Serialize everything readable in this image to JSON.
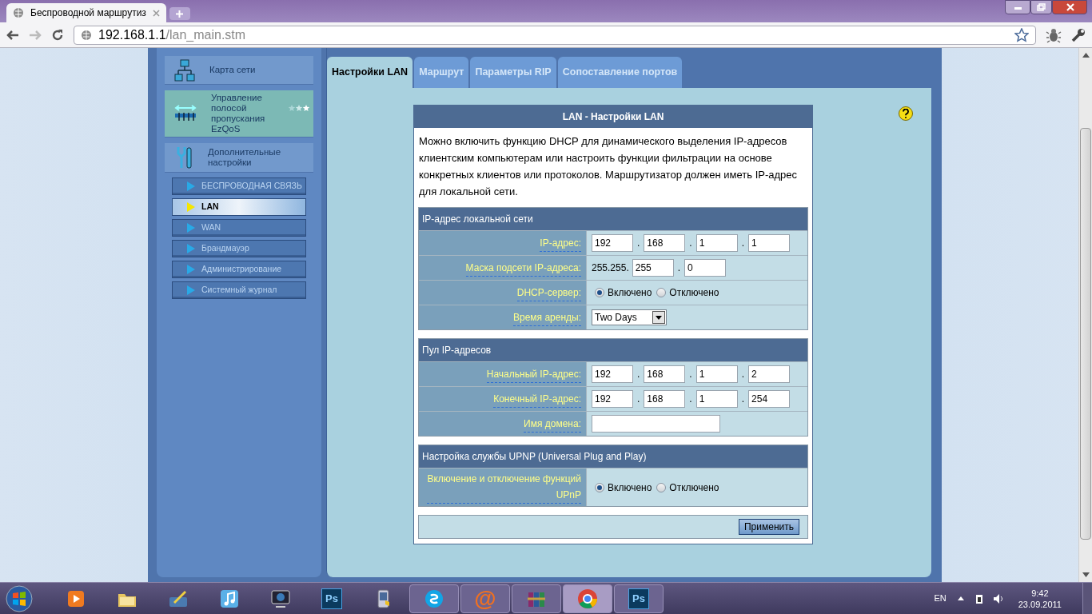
{
  "browser": {
    "tab_title": "Беспроводной маршрутиз",
    "url_host": "192.168.1.1",
    "url_path": "/lan_main.stm"
  },
  "sidebar": {
    "menu": [
      {
        "label": "Карта сети",
        "kind": "network",
        "selected": false
      },
      {
        "label": "Управление полосой пропускания EzQoS",
        "kind": "qos",
        "selected": true
      },
      {
        "label": "Дополнительные настройки",
        "kind": "tools",
        "selected": false
      }
    ],
    "submenu": [
      {
        "label": "БЕСПРОВОДНАЯ СВЯЗЬ",
        "selected": false
      },
      {
        "label": "LAN",
        "selected": true
      },
      {
        "label": "WAN",
        "selected": false
      },
      {
        "label": "Брандмауэр",
        "selected": false
      },
      {
        "label": "Администрирование",
        "selected": false
      },
      {
        "label": "Системный журнал",
        "selected": false
      }
    ]
  },
  "tabs": [
    {
      "label": "Настройки LAN",
      "selected": true
    },
    {
      "label": "Маршрут",
      "selected": false
    },
    {
      "label": "Параметры RIP",
      "selected": false
    },
    {
      "label": "Сопоставление портов",
      "selected": false
    }
  ],
  "panel": {
    "title": "LAN - Настройки LAN",
    "description": "Можно включить функцию DHCP для динамического выделения IP-адресов клиентским компьютерам или настроить функции фильтрации на основе конкретных клиентов или протоколов. Маршрутизатор должен иметь IP-адрес для локальной сети.",
    "sections": [
      {
        "title": "IP-адрес локальной сети",
        "rows": [
          {
            "kind": "ip",
            "label": "IP-адрес:",
            "separator": ".",
            "values": [
              "192",
              "168",
              "1",
              "1"
            ]
          },
          {
            "kind": "ip",
            "label": "Маска подсети IP-адреса:",
            "prefix": "255.255.",
            "separator": ".",
            "values": [
              "255",
              "0"
            ]
          },
          {
            "kind": "radio",
            "label": "DHCP-сервер:",
            "options": [
              {
                "label": "Включено",
                "selected": true
              },
              {
                "label": "Отключено",
                "selected": false
              }
            ]
          },
          {
            "kind": "select",
            "label": "Время аренды:",
            "value": "Two Days"
          }
        ]
      },
      {
        "title": "Пул IP-адресов",
        "rows": [
          {
            "kind": "ip",
            "label": "Начальный IP-адрес:",
            "separator": ".",
            "values": [
              "192",
              "168",
              "1",
              "2"
            ]
          },
          {
            "kind": "ip",
            "label": "Конечный IP-адрес:",
            "separator": ".",
            "values": [
              "192",
              "168",
              "1",
              "254"
            ]
          },
          {
            "kind": "text",
            "label": "Имя домена:"
          }
        ]
      },
      {
        "title": "Настройка службы UPNP (Universal Plug and Play)",
        "rows": [
          {
            "kind": "radio",
            "label": "Включение и отключение функций UPnP",
            "options": [
              {
                "label": "Включено",
                "selected": true
              },
              {
                "label": "Отключено",
                "selected": false
              }
            ]
          }
        ]
      }
    ],
    "apply_button": "Применить"
  },
  "taskbar": {
    "apps": [
      {
        "kind": "player",
        "open": false
      },
      {
        "kind": "folder",
        "open": false
      },
      {
        "kind": "paint",
        "open": false
      },
      {
        "kind": "music",
        "open": false
      },
      {
        "kind": "monitor",
        "open": false
      },
      {
        "kind": "ps",
        "label": "Ps",
        "open": false
      },
      {
        "kind": "phone",
        "open": false
      },
      {
        "kind": "cloud",
        "open": true
      },
      {
        "kind": "at",
        "label": "@",
        "open": true
      },
      {
        "kind": "books",
        "open": true
      },
      {
        "kind": "wheel",
        "open": true,
        "active": true
      },
      {
        "kind": "ps",
        "label": "Ps",
        "open": true
      }
    ],
    "language": "EN",
    "time": "9:42",
    "date": "23.09.2011"
  }
}
